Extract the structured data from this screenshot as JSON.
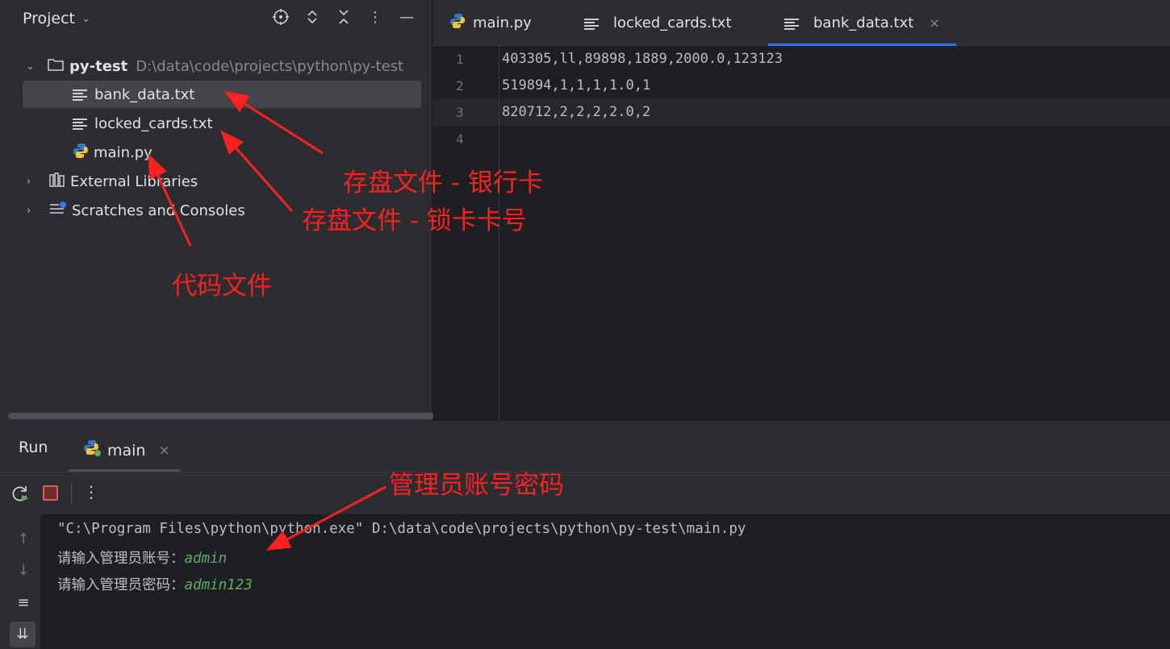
{
  "project": {
    "title": "Project",
    "root": {
      "name": "py-test",
      "path": "D:\\data\\code\\projects\\python\\py-test"
    },
    "files": [
      "bank_data.txt",
      "locked_cards.txt",
      "main.py"
    ],
    "external_libraries": "External Libraries",
    "scratches": "Scratches and Consoles"
  },
  "editor": {
    "tabs": [
      {
        "label": "main.py",
        "icon": "python-icon"
      },
      {
        "label": "locked_cards.txt",
        "icon": "text-file-icon"
      },
      {
        "label": "bank_data.txt",
        "icon": "text-file-icon",
        "close": "×"
      }
    ],
    "line_numbers": [
      "1",
      "2",
      "3",
      "4"
    ],
    "lines": [
      "403305,ll,89898,1889,2000.0,123123",
      "519894,1,1,1,1.0,1",
      "820712,2,2,2,2.0,2",
      ""
    ]
  },
  "run": {
    "title": "Run",
    "tab_label": "main",
    "tab_close": "×",
    "console": {
      "command": "\"C:\\Program Files\\python\\python.exe\" D:\\data\\code\\projects\\python\\py-test\\main.py",
      "prompt1": "请输入管理员账号：",
      "input1": "admin",
      "prompt2": "请输入管理员密码：",
      "input2": "admin123"
    }
  },
  "annotations": {
    "bank_file": "存盘文件 - 银行卡",
    "locked_file": "存盘文件 - 锁卡卡号",
    "code_file": "代码文件",
    "admin": "管理员账号密码"
  },
  "colors": {
    "accent": "#3574f0",
    "annotation": "#ff2020",
    "console_input": "#5fad65"
  }
}
